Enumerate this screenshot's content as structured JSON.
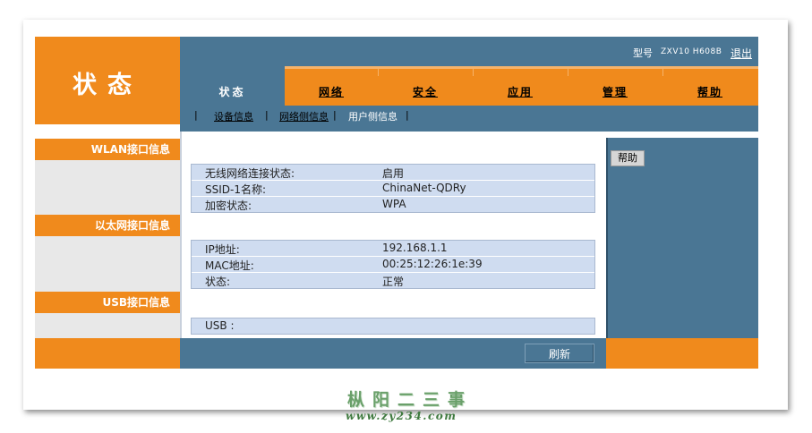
{
  "logo": {
    "title": "状态"
  },
  "header": {
    "model_label": "型号",
    "model_value": "ZXV10 H608B",
    "logout": "退出"
  },
  "tabs": [
    {
      "label": "状态",
      "active": true
    },
    {
      "label": "网络"
    },
    {
      "label": "安全"
    },
    {
      "label": "应用"
    },
    {
      "label": "管理"
    },
    {
      "label": "帮助"
    }
  ],
  "subnav": [
    {
      "label": "设备信息"
    },
    {
      "label": "网络侧信息"
    },
    {
      "label": "用户侧信息",
      "active": true
    }
  ],
  "sections": {
    "wlan": {
      "title": "WLAN接口信息",
      "rows": [
        {
          "key": "无线网络连接状态:",
          "value": "启用"
        },
        {
          "key": "SSID-1名称:",
          "value": "ChinaNet-QDRy"
        },
        {
          "key": "加密状态:",
          "value": "WPA"
        }
      ]
    },
    "ethernet": {
      "title": "以太网接口信息",
      "rows": [
        {
          "key": "IP地址:",
          "value": "192.168.1.1"
        },
        {
          "key": "MAC地址:",
          "value": "00:25:12:26:1e:39"
        },
        {
          "key": "状态:",
          "value": "正常"
        }
      ]
    },
    "usb": {
      "title": "USB接口信息",
      "rows": [
        {
          "key": "USB :",
          "value": ""
        }
      ]
    }
  },
  "help_button": "帮助",
  "refresh_button": "刷新",
  "watermark": {
    "name": "枞阳二三事",
    "url": "www.zy234.com"
  },
  "colors": {
    "orange": "#f08a1c",
    "steel_blue": "#4a7694",
    "row_blue": "#cfdcf0"
  }
}
